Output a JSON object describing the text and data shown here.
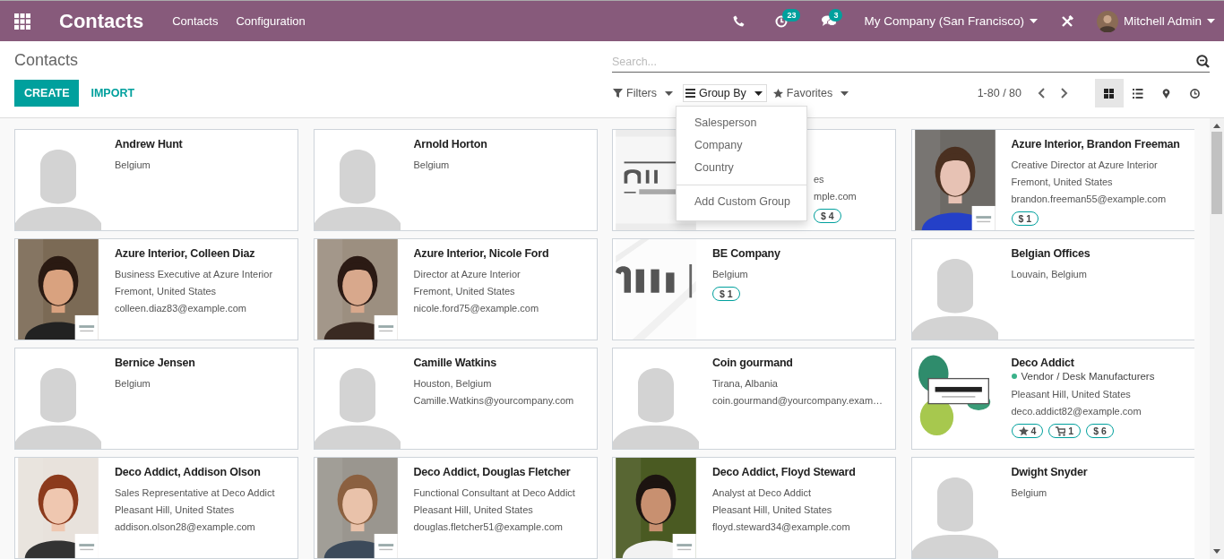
{
  "navbar": {
    "app_title": "Contacts",
    "menu": [
      "Contacts",
      "Configuration"
    ],
    "activity_count": "23",
    "message_count": "3",
    "company": "My Company (San Francisco)",
    "user": "Mitchell Admin"
  },
  "breadcrumb": "Contacts",
  "search": {
    "placeholder": "Search..."
  },
  "buttons": {
    "create": "CREATE",
    "import": "IMPORT"
  },
  "search_options": [
    {
      "label": "Filters",
      "kind": "filter",
      "expanded": false
    },
    {
      "label": "Group By",
      "kind": "group",
      "expanded": true
    },
    {
      "label": "Favorites",
      "kind": "star",
      "expanded": false
    }
  ],
  "group_by_menu": {
    "items": [
      "Salesperson",
      "Company",
      "Country"
    ],
    "custom": "Add Custom Group"
  },
  "pager": "1-80 / 80",
  "views": [
    {
      "kind": "kanban",
      "selected": true
    },
    {
      "kind": "list",
      "selected": false
    },
    {
      "kind": "map",
      "selected": false
    },
    {
      "kind": "activity",
      "selected": false
    }
  ],
  "cards": [
    {
      "name": "Andrew Hunt",
      "kind": "avatar",
      "lines": [
        "Belgium"
      ]
    },
    {
      "name": "Arnold Horton",
      "kind": "avatar",
      "lines": [
        "Belgium"
      ]
    },
    {
      "kind": "logo",
      "lines": [
        "es",
        "mple.com"
      ],
      "tags": [
        {
          "kind": "plain",
          "label": "$ 4"
        }
      ]
    },
    {
      "name": "Azure Interior, Brandon Freeman",
      "lines": [
        "Creative Director at Azure Interior",
        "Fremont, United States",
        "brandon.freeman55@example.com"
      ],
      "tags": [
        {
          "kind": "plain",
          "label": "$ 1"
        }
      ]
    },
    {
      "name": "Azure Interior, Colleen Diaz",
      "lines": [
        "Business Executive at Azure Interior",
        "Fremont, United States",
        "colleen.diaz83@example.com"
      ]
    },
    {
      "name": "Azure Interior, Nicole Ford",
      "lines": [
        "Director at Azure Interior",
        "Fremont, United States",
        "nicole.ford75@example.com"
      ]
    },
    {
      "name": "BE Company",
      "kind": "logo",
      "lines": [
        "Belgium"
      ],
      "tags": [
        {
          "kind": "plain",
          "label": "$ 1"
        }
      ]
    },
    {
      "name": "Belgian Offices",
      "kind": "avatar",
      "lines": [
        "Louvain, Belgium"
      ]
    },
    {
      "name": "Bernice Jensen",
      "kind": "avatar",
      "lines": [
        "Belgium"
      ]
    },
    {
      "name": "Camille Watkins",
      "kind": "avatar",
      "lines": [
        "Houston, Belgium",
        "Camille.Watkins@yourcompany.com"
      ]
    },
    {
      "name": "Coin gourmand",
      "kind": "avatar",
      "lines": [
        "Tirana, Albania",
        "coin.gourmand@yourcompany.exam…"
      ]
    },
    {
      "name": "Deco Addict",
      "kind": "logo",
      "category": {
        "label": "Vendor / Desk Manufacturers",
        "color": "#3ab28a"
      },
      "lines": [
        "Pleasant Hill, United States",
        "deco.addict82@example.com"
      ],
      "tags": [
        {
          "kind": "star",
          "label": "4"
        },
        {
          "kind": "cart",
          "label": "1"
        },
        {
          "kind": "plain",
          "label": "$ 6"
        }
      ]
    },
    {
      "name": "Deco Addict, Addison Olson",
      "lines": [
        "Sales Representative at Deco Addict",
        "Pleasant Hill, United States",
        "addison.olson28@example.com"
      ]
    },
    {
      "name": "Deco Addict, Douglas Fletcher",
      "lines": [
        "Functional Consultant at Deco Addict",
        "Pleasant Hill, United States",
        "douglas.fletcher51@example.com"
      ]
    },
    {
      "name": "Deco Addict, Floyd Steward",
      "lines": [
        "Analyst at Deco Addict",
        "Pleasant Hill, United States",
        "floyd.steward34@example.com"
      ]
    },
    {
      "name": "Dwight Snyder",
      "kind": "avatar",
      "lines": [
        "Belgium"
      ]
    }
  ]
}
